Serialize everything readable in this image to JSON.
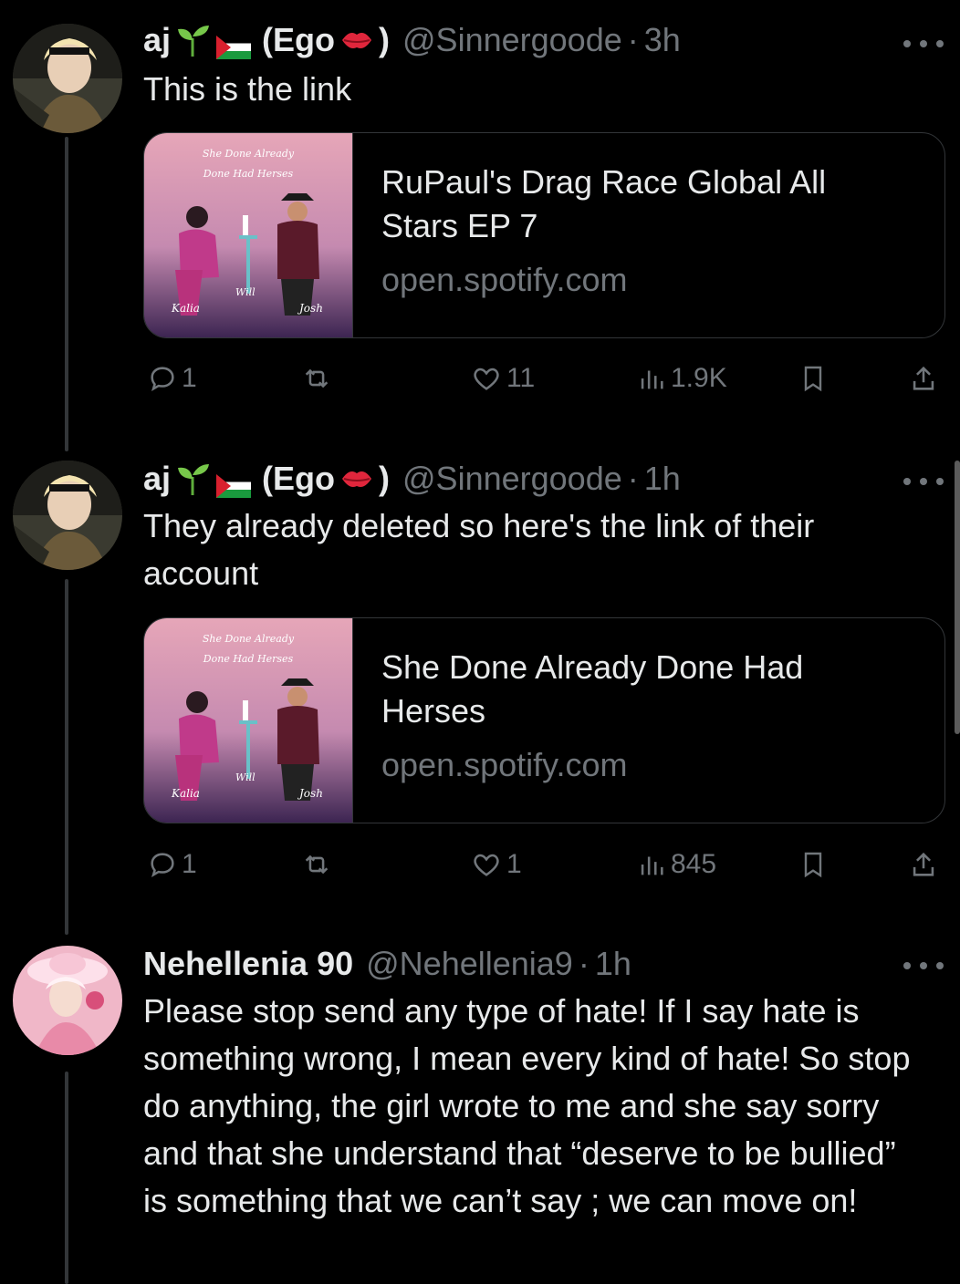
{
  "tweets": [
    {
      "name": "aj",
      "name_suffix_open": "(Ego",
      "name_suffix_close": ")",
      "handle": "@Sinnergoode",
      "dot": "·",
      "time": "3h",
      "text": "This is the link",
      "card": {
        "title": "RuPaul's Drag Race Global All Stars EP 7",
        "domain": "open.spotify.com",
        "art_title_line1": "She Done Already",
        "art_title_line2": "Done Had Herses",
        "art_name_left": "Kalia",
        "art_name_mid": "Will",
        "art_name_right": "Josh"
      },
      "actions": {
        "replies": "1",
        "reposts": "",
        "likes": "11",
        "views": "1.9K"
      }
    },
    {
      "name": "aj",
      "name_suffix_open": "(Ego",
      "name_suffix_close": ")",
      "handle": "@Sinnergoode",
      "dot": "·",
      "time": "1h",
      "text": "They already deleted so here's the link of their account",
      "card": {
        "title": "She Done Already Done Had Herses",
        "domain": "open.spotify.com",
        "art_title_line1": "She Done Already",
        "art_title_line2": "Done Had Herses",
        "art_name_left": "Kalia",
        "art_name_mid": "Will",
        "art_name_right": "Josh"
      },
      "actions": {
        "replies": "1",
        "reposts": "",
        "likes": "1",
        "views": "845"
      }
    },
    {
      "name": "Nehellenia 90",
      "handle": "@Nehellenia9",
      "dot": "·",
      "time": "1h",
      "text": "Please stop send any type of hate! If I say hate is something wrong, I mean every kind of hate! So stop do anything, the girl wrote to me and she say sorry and that she understand that “deserve to be bullied” is something that we can’t say ; we can move on!"
    }
  ],
  "icons": {
    "reply": "reply-icon",
    "repost": "repost-icon",
    "like": "heart-icon",
    "views": "views-icon",
    "bookmark": "bookmark-icon",
    "share": "share-icon",
    "more": "more-icon",
    "seedling": "seedling-emoji",
    "flag": "palestine-flag-emoji",
    "kiss": "kiss-emoji"
  },
  "colors": {
    "background": "#000000",
    "text": "#e7e9ea",
    "muted": "#71767b",
    "border": "#333639"
  }
}
